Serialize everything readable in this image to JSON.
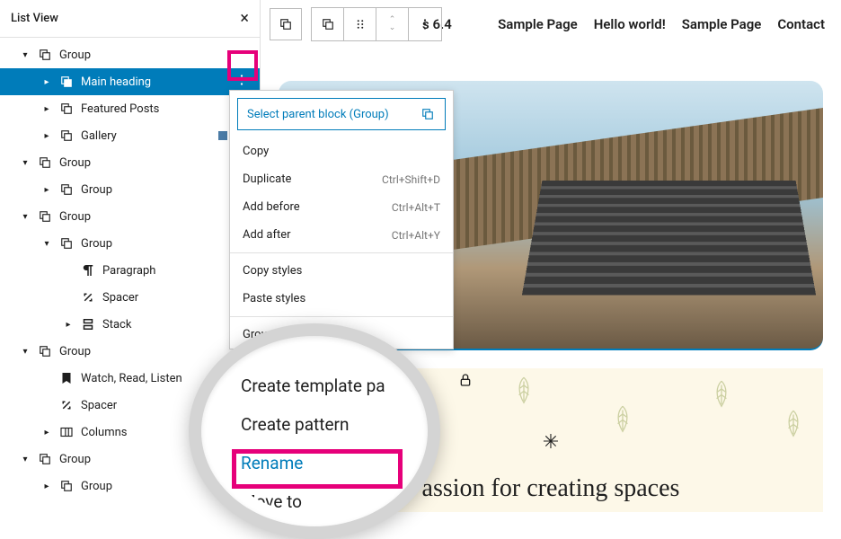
{
  "listView": {
    "title": "List View",
    "items": [
      {
        "chev": "down",
        "indent": 1,
        "icon": "group",
        "label": "Group"
      },
      {
        "chev": "right",
        "indent": 2,
        "icon": "group",
        "label": "Main heading",
        "selected": true,
        "showMore": true
      },
      {
        "chev": "right",
        "indent": 2,
        "icon": "group",
        "label": "Featured Posts"
      },
      {
        "chev": "right",
        "indent": 2,
        "icon": "group",
        "label": "Gallery",
        "thumbs": true
      },
      {
        "chev": "down",
        "indent": 1,
        "icon": "group",
        "label": "Group"
      },
      {
        "chev": "right",
        "indent": 2,
        "icon": "group",
        "label": "Group"
      },
      {
        "chev": "down",
        "indent": 1,
        "icon": "group",
        "label": "Group"
      },
      {
        "chev": "down",
        "indent": 2,
        "icon": "group",
        "label": "Group"
      },
      {
        "chev": "none",
        "indent": 3,
        "icon": "paragraph",
        "label": "Paragraph"
      },
      {
        "chev": "none",
        "indent": 3,
        "icon": "spacer",
        "label": "Spacer"
      },
      {
        "chev": "right",
        "indent": 3,
        "icon": "stack",
        "label": "Stack"
      },
      {
        "chev": "down",
        "indent": 1,
        "icon": "group",
        "label": "Group"
      },
      {
        "chev": "none",
        "indent": 2,
        "icon": "bookmark",
        "label": "Watch, Read, Listen"
      },
      {
        "chev": "none",
        "indent": 2,
        "icon": "spacer",
        "label": "Spacer"
      },
      {
        "chev": "right",
        "indent": 2,
        "icon": "columns",
        "label": "Columns"
      },
      {
        "chev": "down",
        "indent": 1,
        "icon": "group",
        "label": "Group"
      },
      {
        "chev": "right",
        "indent": 2,
        "icon": "group",
        "label": "Group"
      }
    ]
  },
  "dropdown": {
    "parentLabel": "Select parent block (Group)",
    "items": [
      {
        "label": "Copy"
      },
      {
        "label": "Duplicate",
        "shortcut": "Ctrl+Shift+D"
      },
      {
        "label": "Add before",
        "shortcut": "Ctrl+Alt+T"
      },
      {
        "label": "Add after",
        "shortcut": "Ctrl+Alt+Y"
      }
    ],
    "items2": [
      {
        "label": "Copy styles"
      },
      {
        "label": "Paste styles"
      }
    ],
    "items3": [
      {
        "label": "Group"
      }
    ]
  },
  "magnify": {
    "createTemplate": "Create template pa",
    "createPattern": "Create pattern",
    "rename": "Rename",
    "moveTo": "Move to"
  },
  "header": {
    "version": "s 6.4",
    "nav": [
      "Sample Page",
      "Hello world!",
      "Sample Page",
      "Contact"
    ]
  },
  "tagline": "assion for creating spaces",
  "star": "✳"
}
